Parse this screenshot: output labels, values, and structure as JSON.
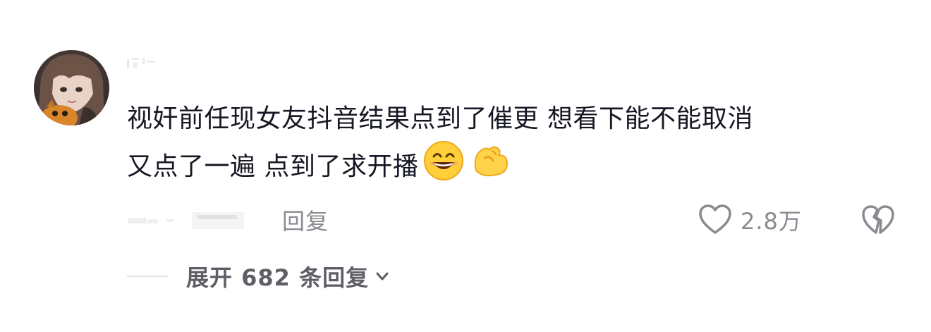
{
  "comment": {
    "lines": [
      "视奸前任现女友抖音结果点到了催更 想看下能不能取消",
      "又点了一遍 点到了求开播"
    ],
    "emojis": [
      "grinning-face-emoji",
      "flexed-biceps-emoji"
    ],
    "reply_label": "回复",
    "like_count": "2.8万"
  },
  "replies": {
    "expand_label": "展开 682 条回复"
  },
  "colors": {
    "text_primary": "#161823",
    "text_secondary": "#8a8b91",
    "expand_text": "#5e5f66"
  }
}
